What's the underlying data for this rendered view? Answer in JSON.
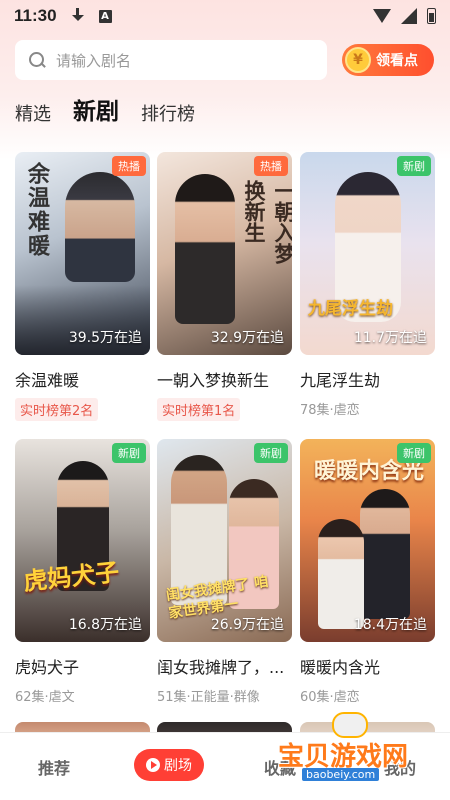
{
  "status": {
    "time": "11:30"
  },
  "search": {
    "placeholder": "请输入剧名"
  },
  "points_button": {
    "label": "领看点",
    "coin": "¥"
  },
  "tabs": [
    {
      "label": "精选",
      "active": false
    },
    {
      "label": "新剧",
      "active": true
    },
    {
      "label": "排行榜",
      "active": false
    }
  ],
  "cards": [
    {
      "title": "余温难暖",
      "poster_text": "余温难暖",
      "badge": "热播",
      "badge_type": "hot",
      "follow": "39.5万在追",
      "rank": "实时榜第2名",
      "meta": ""
    },
    {
      "title": "一朝入梦换新生",
      "poster_text": "一朝入梦换新生",
      "badge": "热播",
      "badge_type": "hot",
      "follow": "32.9万在追",
      "rank": "实时榜第1名",
      "meta": ""
    },
    {
      "title": "九尾浮生劫",
      "poster_text": "九尾浮生劫",
      "badge": "新剧",
      "badge_type": "new",
      "follow": "11.7万在追",
      "rank": "",
      "meta": "78集·虐恋"
    },
    {
      "title": "虎妈犬子",
      "poster_text": "虎妈犬子",
      "badge": "新剧",
      "badge_type": "new",
      "follow": "16.8万在追",
      "rank": "",
      "meta": "62集·虐文"
    },
    {
      "title": "闺女我摊牌了，...",
      "poster_text": "闺女我摊牌了 咱家世界第一",
      "badge": "新剧",
      "badge_type": "new",
      "follow": "26.9万在追",
      "rank": "",
      "meta": "51集·正能量·群像"
    },
    {
      "title": "暖暖内含光",
      "poster_text": "暖暖内含光",
      "badge": "新剧",
      "badge_type": "new",
      "follow": "18.4万在追",
      "rank": "",
      "meta": "60集·虐恋"
    }
  ],
  "bottom_nav": {
    "recommend": "推荐",
    "theater": "剧场",
    "favorites": "收藏",
    "mine": "我的"
  },
  "watermark": {
    "text": "宝贝游戏网",
    "url": "baobeiy.com"
  },
  "colors": {
    "accent": "#ff3f35",
    "hot_badge": "#ff6a3d",
    "new_badge": "#3cc46a"
  }
}
